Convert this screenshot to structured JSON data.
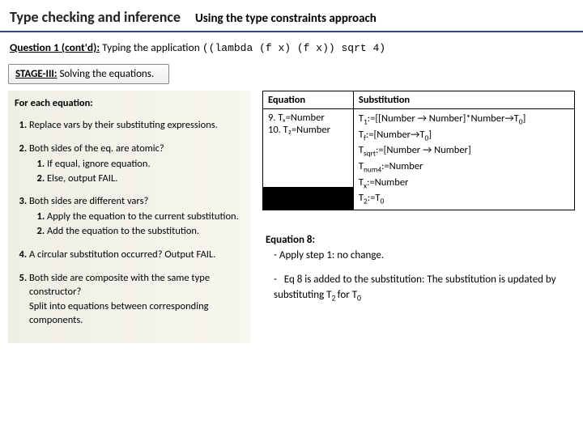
{
  "header": {
    "left": "Type checking and inference",
    "right": "Using the type constraints approach"
  },
  "question": {
    "label": "Question 1 (cont'd):",
    "prefix": "Typing the application",
    "code": "((lambda (f x) (f x)) sqrt 4)"
  },
  "stage": {
    "label": "STAGE-III:",
    "text": "Solving the equations."
  },
  "left": {
    "for_each": "For each equation:",
    "items": [
      {
        "text": "Replace vars by their substituting expressions."
      },
      {
        "text": "Both sides of the eq. are atomic?",
        "sub": [
          "If equal, ignore equation.",
          "Else, output FAIL."
        ]
      },
      {
        "text": "Both sides are different vars?",
        "sub": [
          "Apply the equation to the current substitution.",
          "Add the equation to the substitution."
        ]
      },
      {
        "text": "A circular substitution occurred? Output FAIL."
      },
      {
        "text": "Both side are composite with the same type constructor?",
        "note": "Split into equations between corresponding components."
      }
    ]
  },
  "table": {
    "h1": "Equation",
    "h2": "Substitution",
    "eq_lines": [
      "9. Tₓ=Number",
      "10. T₂=Number"
    ],
    "subs": [
      "T₁:=[[Number → Number]*Number→T₀]",
      "T_f:=[Number→T₀]",
      "T_sqrt:=[Number → Number]",
      "T_num4:=Number",
      "Tₓ:=Number",
      "T₂:=T₀"
    ]
  },
  "notes": {
    "title": "Equation 8:",
    "line1": "-   Apply step 1: no change.",
    "line2": "-   Eq 8 is added to the substitution: The substitution is updated by substituting T₂ for T₀"
  }
}
